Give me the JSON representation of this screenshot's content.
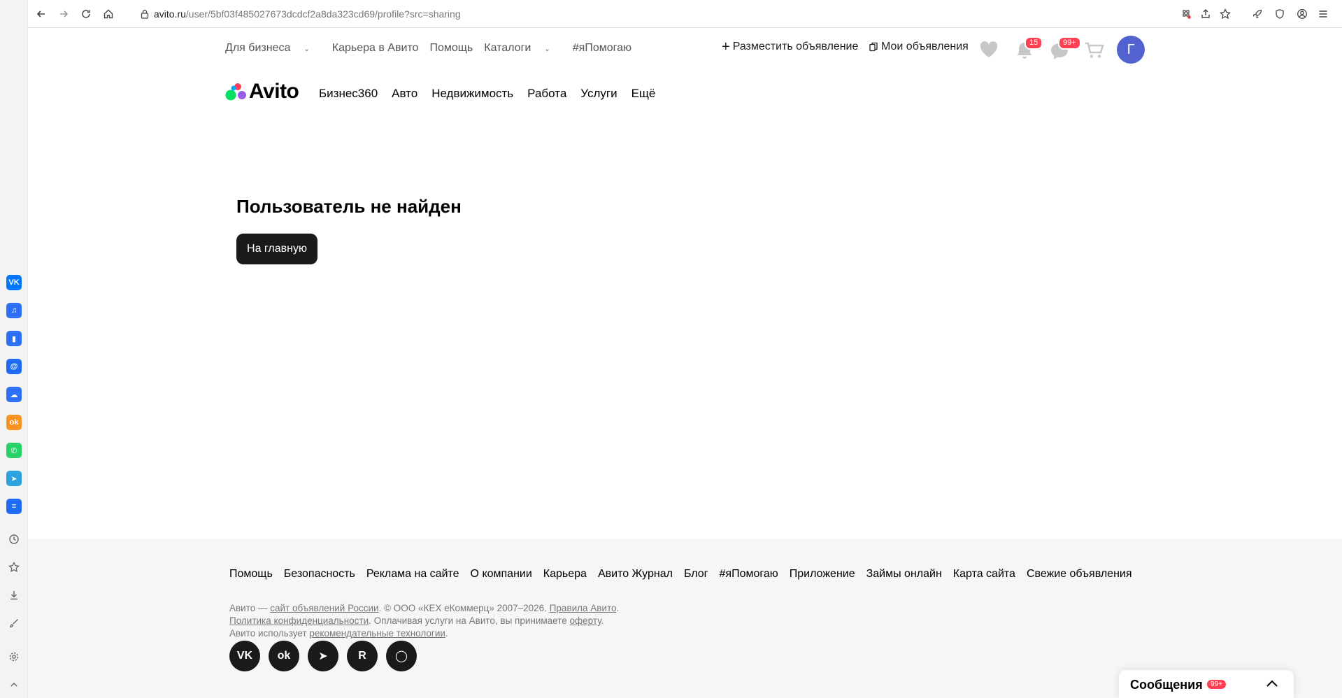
{
  "browser": {
    "url_host": "avito.ru",
    "url_path": "/user/5bf03f485027673dcdcf2a8da323cd69/profile?src=sharing",
    "sidebar_apps": [
      {
        "name": "vk",
        "label": "VK",
        "color": "#0077ff"
      },
      {
        "name": "music",
        "label": "♫",
        "color": "#2d6ff6"
      },
      {
        "name": "stats",
        "label": "▮",
        "color": "#2d6ff6"
      },
      {
        "name": "mail",
        "label": "@",
        "color": "#1f6bf5"
      },
      {
        "name": "cloud",
        "label": "☁",
        "color": "#2d6ff6"
      },
      {
        "name": "ok",
        "label": "ok",
        "color": "#f7931e"
      },
      {
        "name": "whatsapp",
        "label": "✆",
        "color": "#25d366"
      },
      {
        "name": "telegram",
        "label": "➤",
        "color": "#2aa3de"
      },
      {
        "name": "list",
        "label": "≡",
        "color": "#1f6bf5"
      }
    ]
  },
  "topnav": {
    "items": [
      "Для бизнеса",
      "Карьера в Авито",
      "Помощь",
      "Каталоги",
      "#яПомогаю"
    ],
    "post_ad": "Разместить объявление",
    "my_ads": "Мои объявления",
    "notifications_badge": "15",
    "messages_badge": "99+",
    "avatar_letter": "Г"
  },
  "logo": {
    "text": "Avito"
  },
  "categories": [
    "Бизнес360",
    "Авто",
    "Недвижимость",
    "Работа",
    "Услуги",
    "Ещё"
  ],
  "main": {
    "title": "Пользователь не найден",
    "home_button": "На главную"
  },
  "footer": {
    "links": [
      "Помощь",
      "Безопасность",
      "Реклама на сайте",
      "О компании",
      "Карьера",
      "Авито Журнал",
      "Блог",
      "#яПомогаю",
      "Приложение",
      "Займы онлайн",
      "Карта сайта",
      "Свежие объявления"
    ],
    "line1_a": "Авито — ",
    "line1_link1": "сайт объявлений России",
    "line1_b": ". © ООО «КЕХ еКоммерц» 2007–2026. ",
    "line1_link2": "Правила Авито",
    "line1_c": ".",
    "line2_link1": "Политика конфиденциальности",
    "line2_a": ". Оплачивая услуги на Авито, вы принимаете ",
    "line2_link2": "оферту",
    "line2_b": ".",
    "line3_a": "Авито использует ",
    "line3_link": "рекомендательные технологии",
    "line3_b": ".",
    "social": [
      "VK",
      "ok",
      "➤",
      "R",
      "◯"
    ]
  },
  "messages_panel": {
    "label": "Сообщения",
    "badge": "99+"
  },
  "colors": {
    "accent_badge": "#ff4053",
    "avatar": "#5263d0",
    "button_dark": "#1a1a1a"
  }
}
